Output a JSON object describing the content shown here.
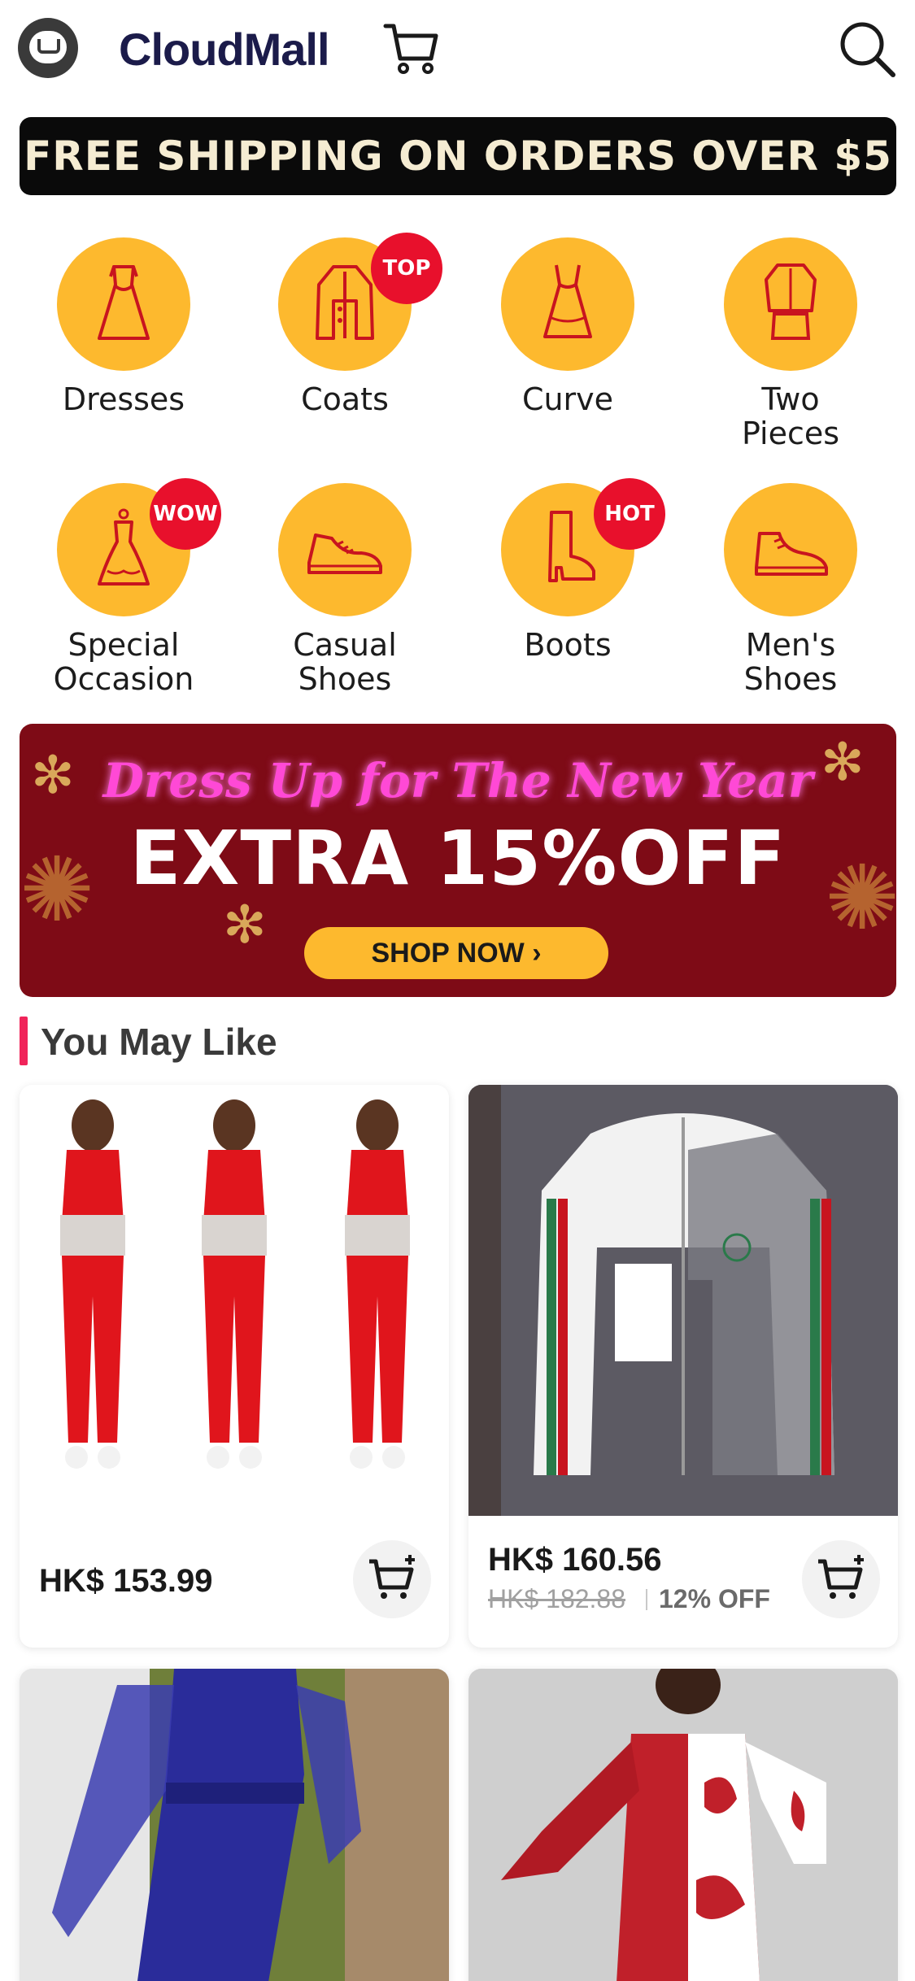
{
  "header": {
    "app_title": "CloudMall",
    "logo_icon": "cloudmall-logo-icon",
    "cart_icon": "cart-icon",
    "search_icon": "search-icon"
  },
  "ship_banner": {
    "text": "FREE SHIPPING ON ORDERS OVER $5"
  },
  "categories": [
    {
      "label": "Dresses",
      "icon": "dress-icon"
    },
    {
      "label": "Coats",
      "icon": "coat-icon",
      "badge": "TOP"
    },
    {
      "label": "Curve",
      "icon": "curve-dress-icon"
    },
    {
      "label": "Two\nPieces",
      "icon": "two-pieces-icon"
    },
    {
      "label": "Special\nOccasion",
      "icon": "gown-icon",
      "badge": "WOW"
    },
    {
      "label": "Casual\nShoes",
      "icon": "sneaker-icon"
    },
    {
      "label": "Boots",
      "icon": "boot-icon",
      "badge": "HOT"
    },
    {
      "label": "Men's\nShoes",
      "icon": "mens-shoe-icon"
    }
  ],
  "promo": {
    "script_text": "Dress Up for The New Year",
    "headline": "EXTRA 15%OFF",
    "cta": "SHOP NOW ›"
  },
  "section": {
    "title": "You May Like"
  },
  "products": [
    {
      "price": "HK$ 153.99",
      "image": "red-gradient-two-piece-set"
    },
    {
      "price": "HK$ 160.56",
      "old_price": "HK$ 182.88",
      "discount": "12% OFF",
      "image": "cuoci-hooded-jacket"
    },
    {
      "image": "blue-mesh-jumpsuit"
    },
    {
      "image": "red-white-flare-sleeve-jumpsuit"
    }
  ],
  "colors": {
    "accent_yellow": "#fdb92e",
    "badge_red": "#e8102c",
    "promo_bg": "#7e0b16",
    "section_bar": "#f0245a",
    "brand_navy": "#1b1b4a"
  }
}
